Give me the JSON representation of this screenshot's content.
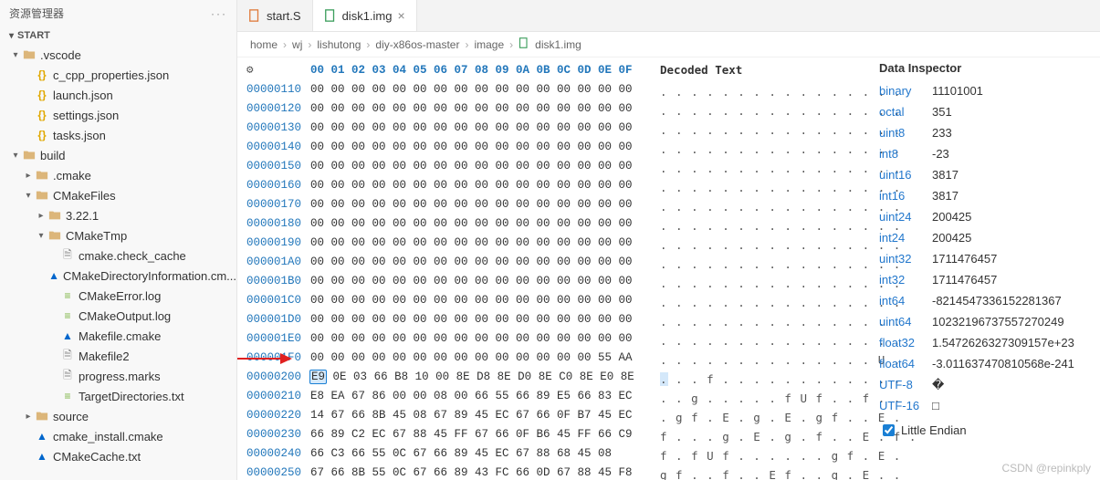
{
  "sidebar": {
    "title": "资源管理器",
    "actions": "···",
    "sectionLabel": "START",
    "tree": [
      {
        "indent": 0,
        "arrow": "v",
        "type": "folder",
        "label": ".vscode"
      },
      {
        "indent": 1,
        "arrow": "",
        "type": "json",
        "label": "c_cpp_properties.json"
      },
      {
        "indent": 1,
        "arrow": "",
        "type": "json",
        "label": "launch.json"
      },
      {
        "indent": 1,
        "arrow": "",
        "type": "json",
        "label": "settings.json"
      },
      {
        "indent": 1,
        "arrow": "",
        "type": "json",
        "label": "tasks.json"
      },
      {
        "indent": 0,
        "arrow": "v",
        "type": "folder",
        "label": "build"
      },
      {
        "indent": 1,
        "arrow": ">",
        "type": "folder",
        "label": ".cmake"
      },
      {
        "indent": 1,
        "arrow": "v",
        "type": "folder",
        "label": "CMakeFiles"
      },
      {
        "indent": 2,
        "arrow": ">",
        "type": "folder",
        "label": "3.22.1"
      },
      {
        "indent": 2,
        "arrow": "v",
        "type": "folder",
        "label": "CMakeTmp"
      },
      {
        "indent": 3,
        "arrow": "",
        "type": "file",
        "label": "cmake.check_cache"
      },
      {
        "indent": 3,
        "arrow": "",
        "type": "cmake",
        "label": "CMakeDirectoryInformation.cm..."
      },
      {
        "indent": 3,
        "arrow": "",
        "type": "txt",
        "label": "CMakeError.log"
      },
      {
        "indent": 3,
        "arrow": "",
        "type": "txt",
        "label": "CMakeOutput.log"
      },
      {
        "indent": 3,
        "arrow": "",
        "type": "cmake",
        "label": "Makefile.cmake"
      },
      {
        "indent": 3,
        "arrow": "",
        "type": "file",
        "label": "Makefile2"
      },
      {
        "indent": 3,
        "arrow": "",
        "type": "file",
        "label": "progress.marks"
      },
      {
        "indent": 3,
        "arrow": "",
        "type": "txt",
        "label": "TargetDirectories.txt"
      },
      {
        "indent": 1,
        "arrow": ">",
        "type": "folder",
        "label": "source"
      },
      {
        "indent": 1,
        "arrow": "",
        "type": "cmake",
        "label": "cmake_install.cmake"
      },
      {
        "indent": 1,
        "arrow": "",
        "type": "cmake",
        "label": "CMakeCache.txt"
      }
    ]
  },
  "tabs": [
    {
      "label": "start.S",
      "active": false,
      "close": false,
      "color": "#e07b3c"
    },
    {
      "label": "disk1.img",
      "active": true,
      "close": true,
      "color": "#3c9e5c"
    }
  ],
  "breadcrumb": [
    "home",
    "wj",
    "lishutong",
    "diy-x86os-master",
    "image",
    "disk1.img"
  ],
  "hex": {
    "header": "00 01 02 03 04 05 06 07 08 09 0A 0B 0C 0D 0E 0F",
    "rows": [
      {
        "o": "00000110",
        "b": "00 00 00 00 00 00 00 00 00 00 00 00 00 00 00 00"
      },
      {
        "o": "00000120",
        "b": "00 00 00 00 00 00 00 00 00 00 00 00 00 00 00 00"
      },
      {
        "o": "00000130",
        "b": "00 00 00 00 00 00 00 00 00 00 00 00 00 00 00 00"
      },
      {
        "o": "00000140",
        "b": "00 00 00 00 00 00 00 00 00 00 00 00 00 00 00 00"
      },
      {
        "o": "00000150",
        "b": "00 00 00 00 00 00 00 00 00 00 00 00 00 00 00 00"
      },
      {
        "o": "00000160",
        "b": "00 00 00 00 00 00 00 00 00 00 00 00 00 00 00 00"
      },
      {
        "o": "00000170",
        "b": "00 00 00 00 00 00 00 00 00 00 00 00 00 00 00 00"
      },
      {
        "o": "00000180",
        "b": "00 00 00 00 00 00 00 00 00 00 00 00 00 00 00 00"
      },
      {
        "o": "00000190",
        "b": "00 00 00 00 00 00 00 00 00 00 00 00 00 00 00 00"
      },
      {
        "o": "000001A0",
        "b": "00 00 00 00 00 00 00 00 00 00 00 00 00 00 00 00"
      },
      {
        "o": "000001B0",
        "b": "00 00 00 00 00 00 00 00 00 00 00 00 00 00 00 00"
      },
      {
        "o": "000001C0",
        "b": "00 00 00 00 00 00 00 00 00 00 00 00 00 00 00 00"
      },
      {
        "o": "000001D0",
        "b": "00 00 00 00 00 00 00 00 00 00 00 00 00 00 00 00"
      },
      {
        "o": "000001E0",
        "b": "00 00 00 00 00 00 00 00 00 00 00 00 00 00 00 00"
      },
      {
        "o": "000001F0",
        "b": "00 00 00 00 00 00 00 00 00 00 00 00 00 00 55 AA"
      },
      {
        "o": "00000200",
        "b": "E9 0E 03 66 B8 10 00 8E D8 8E D0 8E C0 8E E0 8E",
        "hl": 0
      },
      {
        "o": "00000210",
        "b": "E8 EA 67 86 00 00 08 00 66 55 66 89 E5 66 83 EC"
      },
      {
        "o": "00000220",
        "b": "14 67 66 8B 45 08 67 89 45 EC 67 66 0F B7 45 EC"
      },
      {
        "o": "00000230",
        "b": "66 89 C2 EC 67 88 45 FF 67 66 0F B6 45 FF 66 C9"
      },
      {
        "o": "00000240",
        "b": "66 C3 66 55 0C 67 66 89 45 EC 67 88 68 45 08"
      },
      {
        "o": "00000250",
        "b": "67 66 8B 55 0C 67 66 89 43 FC 66 0D 67 88 45 F8"
      }
    ]
  },
  "decoded": {
    "title": "Decoded Text",
    "rows": [
      ". . . . . . . . . . . . . . . .",
      ". . . . . . . . . . . . . . . .",
      ". . . . . . . . . . . . . . . .",
      ". . . . . . . . . . . . . . . .",
      ". . . . . . . . . . . . . . . .",
      ". . . . . . . . . . . . . . . .",
      ". . . . . . . . . . . . . . . .",
      ". . . . . . . . . . . . . . . .",
      ". . . . . . . . . . . . . . . .",
      ". . . . . . . . . . . . . . . .",
      ". . . . . . . . . . . . . . . .",
      ". . . . . . . . . . . . . . . .",
      ". . . . . . . . . . . . . . . .",
      ". . . . . . . . . . . . . . . .",
      ". . . . . . . . . . . . . . U .",
      ". . . f . . . . . . . . . . . .",
      ". . g . . . . . f U f . . f . .",
      ". g f . E . g . E . g f . . E .",
      "f . . . g . E . g . f . . E . f .",
      "f . f U f . . . . . . g f . E .",
      "g f . . f . . E f . . g . E . ."
    ],
    "hlRow": 15
  },
  "inspector": {
    "title": "Data Inspector",
    "rows": [
      {
        "k": "binary",
        "v": "11101001"
      },
      {
        "k": "octal",
        "v": "351"
      },
      {
        "k": "uint8",
        "v": "233"
      },
      {
        "k": "int8",
        "v": "-23"
      },
      {
        "k": "uint16",
        "v": "3817"
      },
      {
        "k": "int16",
        "v": "3817"
      },
      {
        "k": "uint24",
        "v": "200425"
      },
      {
        "k": "int24",
        "v": "200425"
      },
      {
        "k": "uint32",
        "v": "1711476457"
      },
      {
        "k": "int32",
        "v": "1711476457"
      },
      {
        "k": "int64",
        "v": "-8214547336152281367"
      },
      {
        "k": "uint64",
        "v": "10232196737557270249"
      },
      {
        "k": "float32",
        "v": "1.5472626327309157e+23"
      },
      {
        "k": "float64",
        "v": "-3.011637470810568e-241"
      },
      {
        "k": "UTF-8",
        "v": "�"
      },
      {
        "k": "UTF-16",
        "v": "□"
      }
    ],
    "endianLabel": "Little Endian",
    "endianChecked": true
  },
  "watermark": "CSDN @repinkply"
}
